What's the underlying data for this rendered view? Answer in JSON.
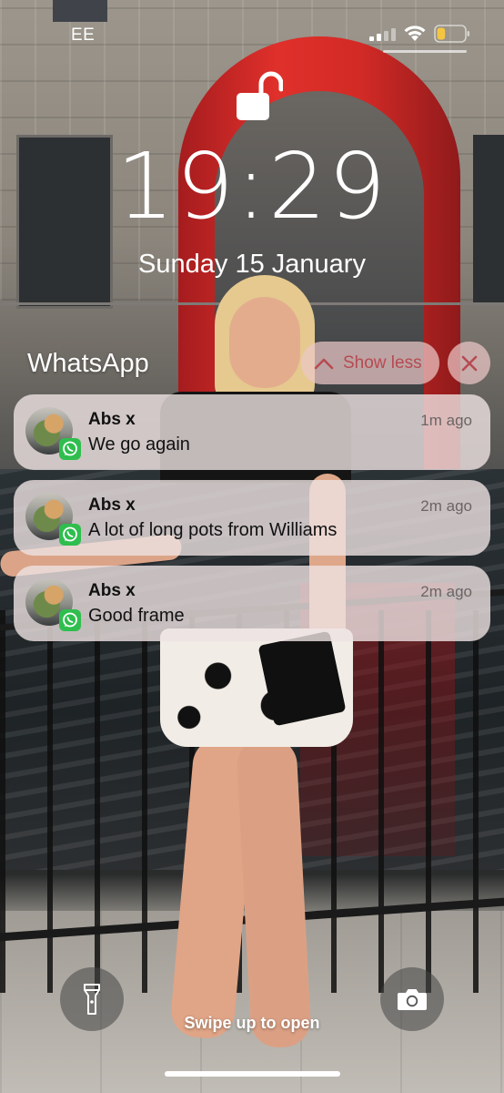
{
  "status_bar": {
    "carrier": "EE",
    "signal_icon": "cellular-signal-icon",
    "wifi_icon": "wifi-icon",
    "battery_icon": "battery-icon",
    "battery_level": 0.3,
    "battery_color": "#f5c542"
  },
  "lock": {
    "icon": "unlocked-padlock-icon",
    "time": "19:29",
    "date": "Sunday 15 January"
  },
  "notification_group": {
    "app_name": "WhatsApp",
    "show_less_label": "Show less",
    "show_less_icon": "chevron-up-icon",
    "clear_icon": "close-icon",
    "accent_color": "#b84a52"
  },
  "notifications": [
    {
      "sender": "Abs x",
      "time": "1m ago",
      "message": "We go again",
      "badge_icon": "whatsapp-icon"
    },
    {
      "sender": "Abs x",
      "time": "2m ago",
      "message": "A lot of long pots from Williams",
      "badge_icon": "whatsapp-icon"
    },
    {
      "sender": "Abs x",
      "time": "2m ago",
      "message": "Good frame",
      "badge_icon": "whatsapp-icon"
    }
  ],
  "bottom": {
    "torch_icon": "flashlight-icon",
    "camera_icon": "camera-icon",
    "swipe_hint": "Swipe up to open"
  }
}
